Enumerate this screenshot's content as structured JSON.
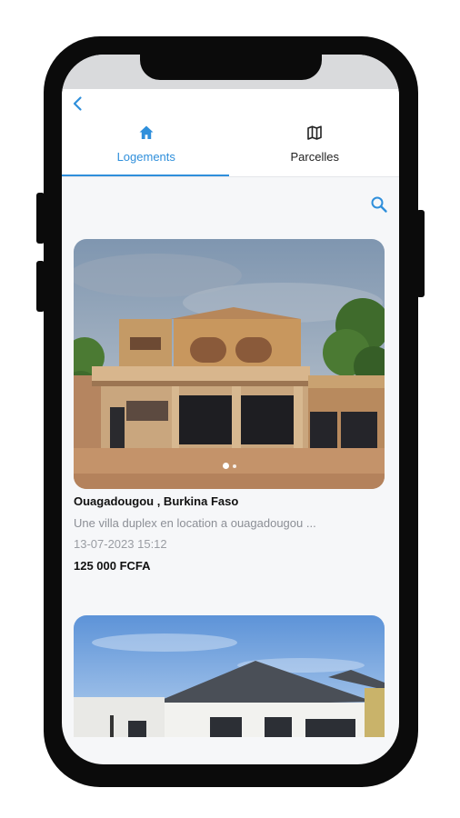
{
  "tabs": [
    {
      "label": "Logements",
      "icon": "home-icon",
      "active": true
    },
    {
      "label": "Parcelles",
      "icon": "map-icon",
      "active": false
    }
  ],
  "colors": {
    "accent": "#2f8fdb",
    "background": "#f6f7f9",
    "muted": "#8c8f96"
  },
  "listings": [
    {
      "location": "Ouagadougou , Burkina Faso",
      "description": "Une villa duplex en location a ouagadougou ...",
      "date": "13-07-2023 15:12",
      "price": "125 000 FCFA",
      "images_count": 2,
      "active_image": 1
    }
  ]
}
